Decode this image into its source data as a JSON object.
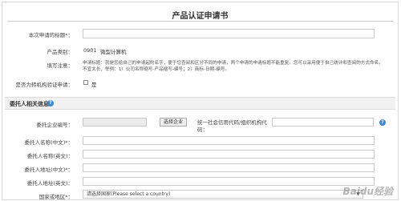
{
  "header": {
    "title": "产品认证申请书"
  },
  "form": {
    "title_label": "本次申请的标题*：",
    "category_label": "产品类别：",
    "category_code": "0901",
    "category_name": "微型计算机",
    "notes_label": "填写注意：",
    "notes_text": "申请标题：就是您给自己的申请起的名字，便于您查阅和区分不同的申请，两个申请的申请标题不能重复。您可以采用便于自己统计和查阅的方式命名，不宜太长，举例：1）公司名称缩写-产品缩写-编号；2）商标-日期-编号。",
    "transfer_label": "是否为转机构验证申请：",
    "transfer_option": "是"
  },
  "section": {
    "title": "委托人相关信息",
    "help_icon": "?"
  },
  "client": {
    "company_no_label": "委托企业编号：",
    "select_company_button": "选择企业",
    "credit_code_label": "统一社会信用代码/组织机构代码：",
    "name_cn_label": "委托人名称(中文)*：",
    "name_en_label": "委托人名称(英文)：",
    "addr_cn_label": "委托人地址(中文)*：",
    "addr_en_label": "委托人地址(英文)：",
    "country_label": "国家或地区*：",
    "country_placeholder": "请选择国家(Please select a country)"
  },
  "watermark": "Baidu经验"
}
